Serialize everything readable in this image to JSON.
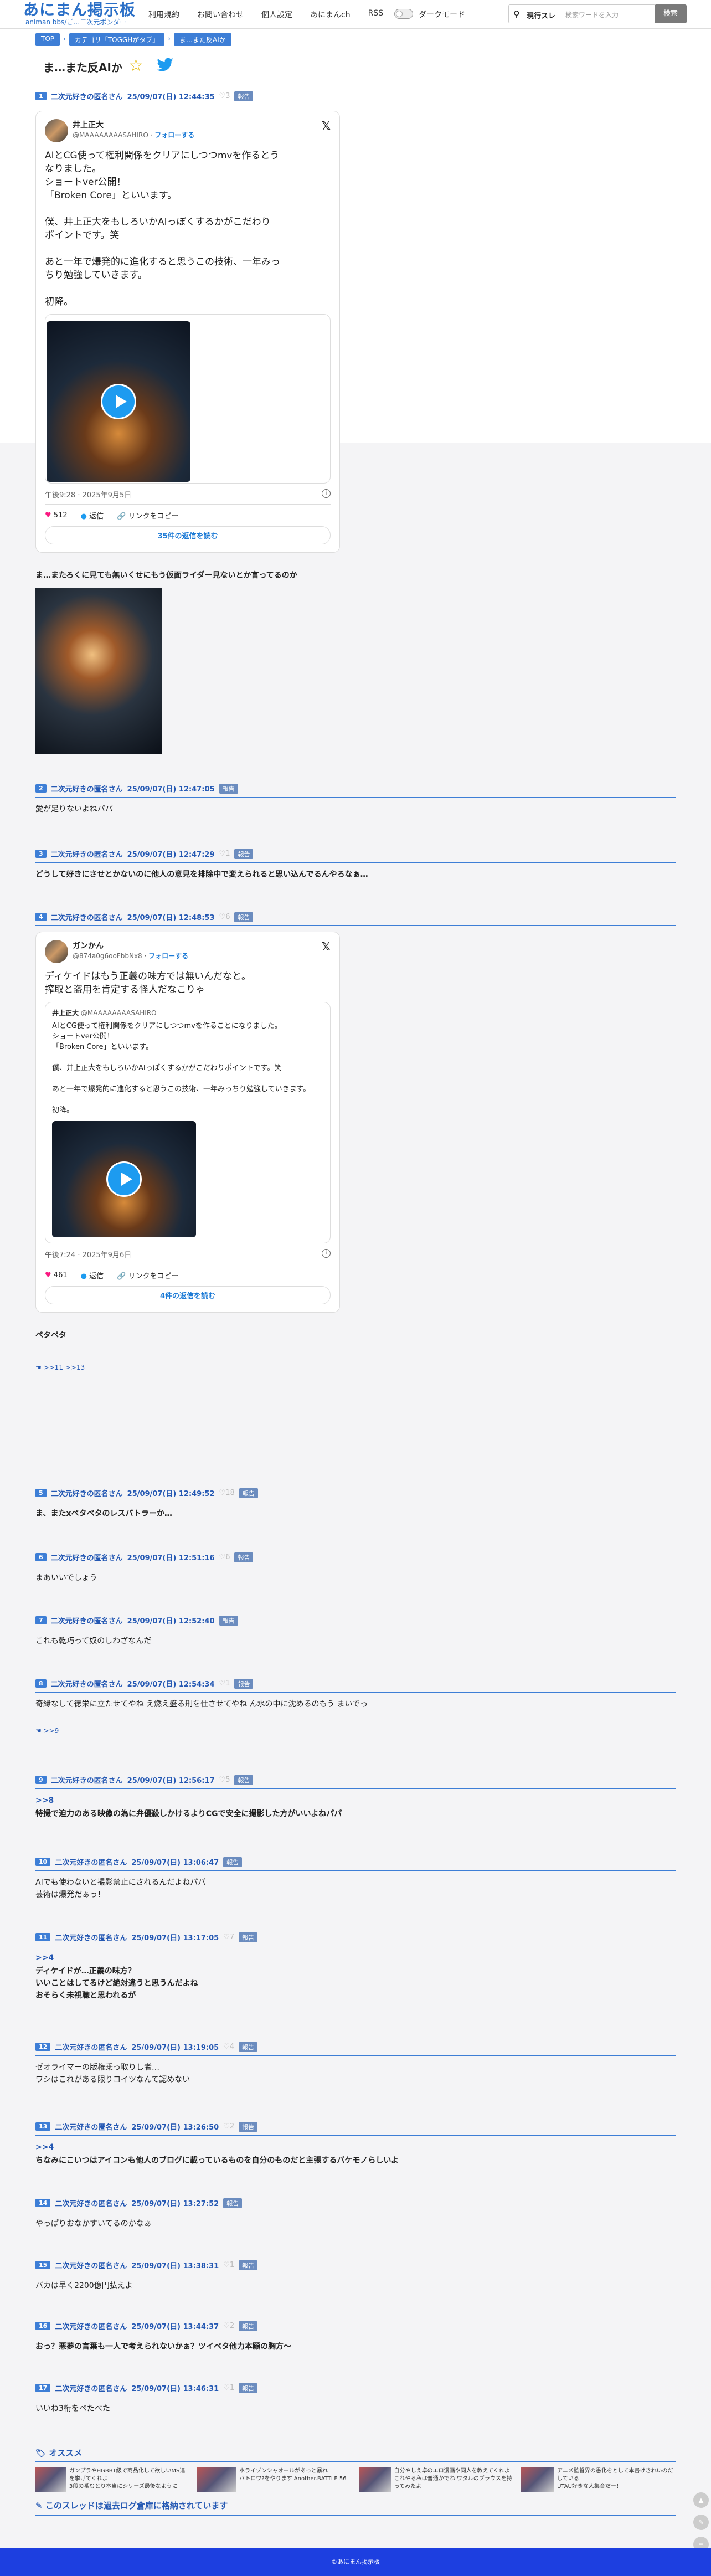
{
  "site": {
    "logo": "あにまん掲示板",
    "logo_sub": "animan bbs/ご…二次元ポンダー"
  },
  "nav": [
    "利用規約",
    "お問い合わせ",
    "個人設定",
    "あにまんch",
    "RSS"
  ],
  "darkmode_label": "ダークモード",
  "search": {
    "type": "現行スレ",
    "placeholder": "検索ワードを入力",
    "button": "検索"
  },
  "breadcrumbs": [
    "TOP",
    "カテゴリ「TOGGHがタブ」",
    "ま…また反AIか"
  ],
  "thread_title": "ま…また反AIか",
  "posts": [
    {
      "num": "1",
      "author": "二次元好きの匿名さん",
      "date": "25/09/07(日) 12:44:35",
      "likes": "3",
      "report": "報告"
    },
    {
      "num": "2",
      "author": "二次元好きの匿名さん",
      "date": "25/09/07(日) 12:47:05",
      "likes": "",
      "report": "報告",
      "body": "愛が足りないよねパパ"
    },
    {
      "num": "3",
      "author": "二次元好きの匿名さん",
      "date": "25/09/07(日) 12:47:29",
      "likes": "1",
      "report": "報告",
      "body": "どうして好きにさせとかないのに他人の意見を排除中で変えられると思い込んでるんやろなぁ…"
    },
    {
      "num": "4",
      "author": "二次元好きの匿名さん",
      "date": "25/09/07(日) 12:48:53",
      "likes": "6",
      "report": "報告",
      "body": "ペタペタ"
    },
    {
      "num": "5",
      "author": "二次元好きの匿名さん",
      "date": "25/09/07(日) 12:49:52",
      "likes": "18",
      "report": "報告",
      "body": "ま、またxペタペタのレスバトラーか…"
    },
    {
      "num": "6",
      "author": "二次元好きの匿名さん",
      "date": "25/09/07(日) 12:51:16",
      "likes": "6",
      "report": "報告",
      "body": "まあいいでしょう"
    },
    {
      "num": "7",
      "author": "二次元好きの匿名さん",
      "date": "25/09/07(日) 12:52:40",
      "likes": "",
      "report": "報告",
      "body": "これも乾巧って奴のしわざなんだ"
    },
    {
      "num": "8",
      "author": "二次元好きの匿名さん",
      "date": "25/09/07(日) 12:54:34",
      "likes": "1",
      "report": "報告",
      "body": "奇縁なして徳栄に立たせてやね え燃え盛る刑を仕させてやね ん水の中に沈めるのもう まいでっ"
    },
    {
      "num": "9",
      "author": "二次元好きの匿名さん",
      "date": "25/09/07(日) 12:56:17",
      "likes": "5",
      "report": "報告",
      "anchor": ">>8",
      "body": "特撮で迫力のある映像の為に弁優殺しかけるよりCGで安全に撮影した方がいいよねパパ"
    },
    {
      "num": "10",
      "author": "二次元好きの匿名さん",
      "date": "25/09/07(日) 13:06:47",
      "likes": "",
      "report": "報告",
      "body": "AIでも使わないと撮影禁止にされるんだよねパパ\n芸術は爆発だぁっ！"
    },
    {
      "num": "11",
      "author": "二次元好きの匿名さん",
      "date": "25/09/07(日) 13:17:05",
      "likes": "7",
      "report": "報告",
      "anchor": ">>4",
      "body": "ディケイドが…正義の味方？\nいいことはしてるけど絶対違うと思うんだよね\nおそらく未視聴と思われるが"
    },
    {
      "num": "12",
      "author": "二次元好きの匿名さん",
      "date": "25/09/07(日) 13:19:05",
      "likes": "4",
      "report": "報告",
      "body": "ゼオライマーの版権乗っ取りし者…\nワシはこれがある限りコイツなんて認めない"
    },
    {
      "num": "13",
      "author": "二次元好きの匿名さん",
      "date": "25/09/07(日) 13:26:50",
      "likes": "2",
      "report": "報告",
      "anchor": ">>4",
      "body": "ちなみにこいつはアイコンも他人のブログに載っているものを自分のものだと主張するバケモノらしいよ"
    },
    {
      "num": "14",
      "author": "二次元好きの匿名さん",
      "date": "25/09/07(日) 13:27:52",
      "likes": "",
      "report": "報告",
      "body": "やっぱりおなかすいてるのかなぁ"
    },
    {
      "num": "15",
      "author": "二次元好きの匿名さん",
      "date": "25/09/07(日) 13:38:31",
      "likes": "1",
      "report": "報告",
      "body": "バカは早く2200億円払えよ"
    },
    {
      "num": "16",
      "author": "二次元好きの匿名さん",
      "date": "25/09/07(日) 13:44:37",
      "likes": "2",
      "report": "報告",
      "body": "おっ？悪夢の言葉も一人で考えられないかぁ？ツイペタ他力本願の胸方～"
    },
    {
      "num": "17",
      "author": "二次元好きの匿名さん",
      "date": "25/09/07(日) 13:46:31",
      "likes": "1",
      "report": "報告",
      "body": "いいね3桁をぺたべた"
    }
  ],
  "tweet1": {
    "name": "井上正大",
    "handle": "@MAAAAAAAASAHIRO",
    "follow": "フォローする",
    "text": "AIとCG使って権利関係をクリアにしつつmvを作るとう\nなりました。\nショートver公開！\n「Broken Core」といいます。\n\n僕、井上正大をもしろいかAIっぽくするかがこだわり\nポイントです。笑\n\nあと一年で爆発的に進化すると思うこの技術、一年みっ\nちり勉強していきます。\n\n初降。",
    "date": "午後9:28 · 2025年9月5日",
    "likes": "512",
    "reply": "返信",
    "copy": "リンクをコピー",
    "replies": "35件の返信を読む"
  },
  "post1_caption": "ま…またろくに見ても無いくせにもう仮面ライダー見ないとか言ってるのか",
  "tweet2": {
    "name": "ガンかん",
    "handle": "@874a0g6ooFbbNx8",
    "follow": "フォローする",
    "text": "ディケイドはもう正義の味方では無いんだなと。\n搾取と盗用を肯定する怪人だなこりゃ",
    "quote_name": "井上正大",
    "quote_handle": "@MAAAAAAAASAHIRO",
    "quote_text": "AIとCG使って権利関係をクリアにしつつmvを作ることになりました。\nショートver公開！\n「Broken Core」といいます。\n\n僕、井上正大をもしろいかAIっぽくするかがこだわりポイントです。笑\n\nあと一年で爆発的に進化すると思うこの技術、一年みっちり勉強していきます。\n\n初降。",
    "date": "午後7:24 · 2025年9月6日",
    "likes": "461",
    "reply": "返信",
    "copy": "リンクをコピー",
    "replies": "4件の返信を読む"
  },
  "res_links_4": "☚ >>11 >>13",
  "res_links_8": "☚ >>9",
  "recommend": {
    "title": "オススメ",
    "items": [
      "ガンプラやHGBBT級で商品化して欲しいMS達を挙げてくれよ",
      "ホライゾンシャオールがあっと暴れ",
      "自分やしえ卓のエロ漫画や同人を教えてくれよ",
      "アニメ監督界の愚化をとして本書けきれいのだしている",
      "3段の番むとり本当にシリーズ最後なように",
      "バトロワ?をやります Another.BATTLE 56",
      "これやる私は普通かでね ワタルのブラウスを持ってみたよ",
      "UTAU好きな人集合だー！"
    ]
  },
  "archived": "このスレッドは過去ログ倉庫に格納されています",
  "footer": "©あにまん掲示板"
}
